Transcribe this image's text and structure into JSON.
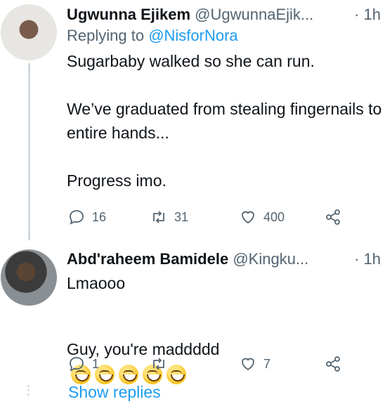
{
  "tweets": [
    {
      "name": "Ugwunna Ejikem",
      "handle": "@UgwunnaEjik...",
      "time": "· 1h",
      "replying_prefix": "Replying to ",
      "replying_to": "@NisforNora",
      "text": "Sugarbaby walked so she can run.\n\nWe’ve graduated from stealing fingernails to entire hands...\n\nProgress imo.",
      "replies": "16",
      "retweets": "31",
      "likes": "400"
    },
    {
      "name": "Abd'raheem Bamidele",
      "handle": "@Kingku...",
      "time": "· 1h",
      "text_line1": "Lmaooo",
      "text_line2": "Guy, you're maddddd",
      "emoji_count": 5,
      "replies": "1",
      "retweets": "",
      "likes": "7"
    }
  ],
  "show_replies_label": "Show replies",
  "icons": [
    "reply-icon",
    "retweet-icon",
    "like-icon",
    "share-icon",
    "grinning-emoji"
  ],
  "colors": {
    "accent": "#1d9bf0",
    "muted": "#536471",
    "text": "#0f1419",
    "line": "#cfd9de"
  }
}
